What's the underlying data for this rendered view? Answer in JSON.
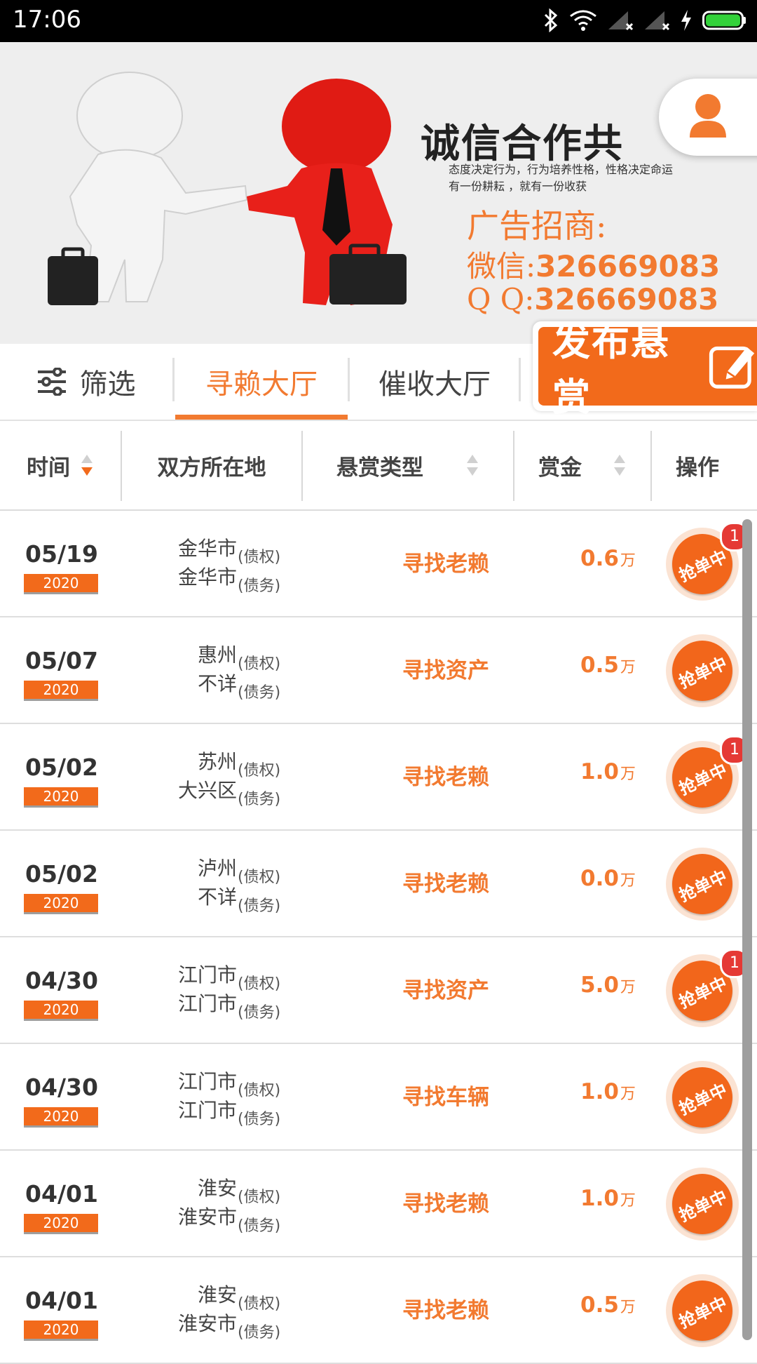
{
  "status_bar": {
    "time": "17:06"
  },
  "banner": {
    "slogan": "诚信合作共",
    "sub_line_1": "态度决定行为，行为培养性格，性格决定命运",
    "sub_line_2": "有一份耕耘 ，就有一份收获",
    "ad_title": "广告招商:",
    "wechat_label": "微信:",
    "wechat_value": "326669083",
    "qq_label": "Q  Q:",
    "qq_value": "326669083"
  },
  "tabs": {
    "filter": "筛选",
    "hunt_hall": "寻赖大厅",
    "collect_hall": "催收大厅",
    "publish": "发布悬赏"
  },
  "table": {
    "headers": {
      "time": "时间",
      "location": "双方所在地",
      "type": "悬赏类型",
      "reward": "赏金",
      "action": "操作"
    },
    "creditor_tag": "(债权)",
    "debtor_tag": "(债务)",
    "unit": "万",
    "action_label": "抢单中",
    "rows": [
      {
        "date": "05/19",
        "year": "2020",
        "creditor": "金华市",
        "debtor": "金华市",
        "type": "寻找老赖",
        "amount": "0.6",
        "badge": "1"
      },
      {
        "date": "05/07",
        "year": "2020",
        "creditor": "惠州",
        "debtor": "不详",
        "type": "寻找资产",
        "amount": "0.5",
        "badge": ""
      },
      {
        "date": "05/02",
        "year": "2020",
        "creditor": "苏州",
        "debtor": "大兴区",
        "type": "寻找老赖",
        "amount": "1.0",
        "badge": "1"
      },
      {
        "date": "05/02",
        "year": "2020",
        "creditor": "泸州",
        "debtor": "不详",
        "type": "寻找老赖",
        "amount": "0.0",
        "badge": ""
      },
      {
        "date": "04/30",
        "year": "2020",
        "creditor": "江门市",
        "debtor": "江门市",
        "type": "寻找资产",
        "amount": "5.0",
        "badge": "1"
      },
      {
        "date": "04/30",
        "year": "2020",
        "creditor": "江门市",
        "debtor": "江门市",
        "type": "寻找车辆",
        "amount": "1.0",
        "badge": ""
      },
      {
        "date": "04/01",
        "year": "2020",
        "creditor": "淮安",
        "debtor": "淮安市",
        "type": "寻找老赖",
        "amount": "1.0",
        "badge": ""
      },
      {
        "date": "04/01",
        "year": "2020",
        "creditor": "淮安",
        "debtor": "淮安市",
        "type": "寻找老赖",
        "amount": "0.5",
        "badge": ""
      }
    ]
  },
  "colors": {
    "accent": "#f27a30",
    "button": "#f26a1b",
    "badge": "#e53935"
  },
  "icons": [
    "bluetooth-icon",
    "wifi-icon",
    "signal-icon",
    "charging-icon",
    "battery-icon",
    "user-icon",
    "filter-icon",
    "edit-icon",
    "sort-icon"
  ]
}
